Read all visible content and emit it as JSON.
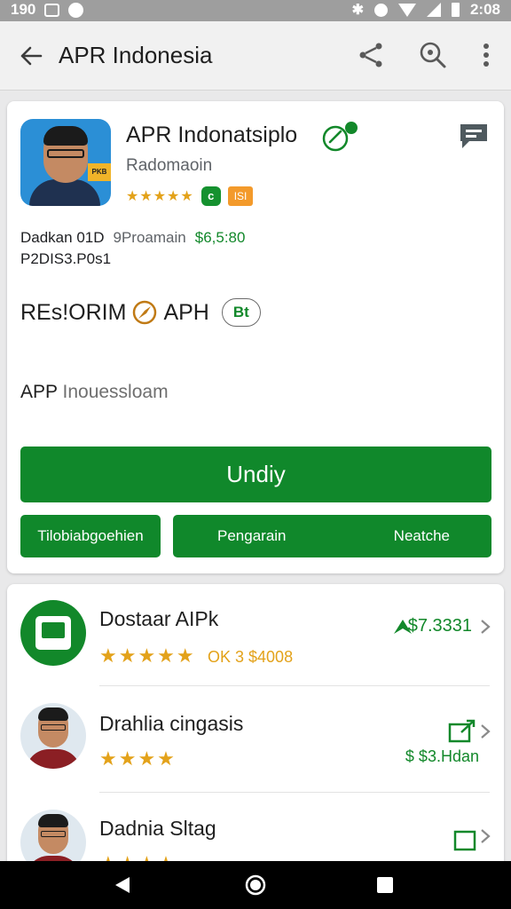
{
  "status_bar": {
    "time_left": "190",
    "time_right": "2:08"
  },
  "app_bar": {
    "title": "APR Indonesia",
    "back_icon": "arrow-back-icon",
    "share_icon": "share-icon",
    "search_icon": "search-icon",
    "more_icon": "more-vert-icon"
  },
  "app": {
    "name": "APR Indonatsiplo",
    "developer": "Radomaoin",
    "rating_stars": "★★★★★",
    "badge_green": "c",
    "badge_orange": "ISI",
    "meta_line1_a": "Dadkan 01D",
    "meta_line1_b": "9Proamain",
    "meta_line1_price": "$6,5:80",
    "meta_line2": "P2DIS3.P0s1",
    "category_a": "REs!ORIM",
    "category_b": "APH",
    "category_chip": "Bt",
    "description_a": "APP",
    "description_b": "Inouessloam",
    "install_label": "Undiy",
    "button_left": "Tilobiabgoehien",
    "button_mid": "Pengarain",
    "button_right": "Neatche"
  },
  "list": [
    {
      "title": "Dostaar AIPk",
      "stars": "★★★★★",
      "sub": "OK 3 $4008",
      "price": "$7.3331"
    },
    {
      "title": "Drahlia cingasis",
      "stars": "★★★★",
      "price": "$ $3.Hdan"
    },
    {
      "title": "Dadnia Sltag",
      "stars": "★★★★",
      "price": ""
    }
  ],
  "colors": {
    "accent_green": "#10882b",
    "star_yellow": "#e3a21a",
    "badge_orange": "#f39a2b"
  }
}
